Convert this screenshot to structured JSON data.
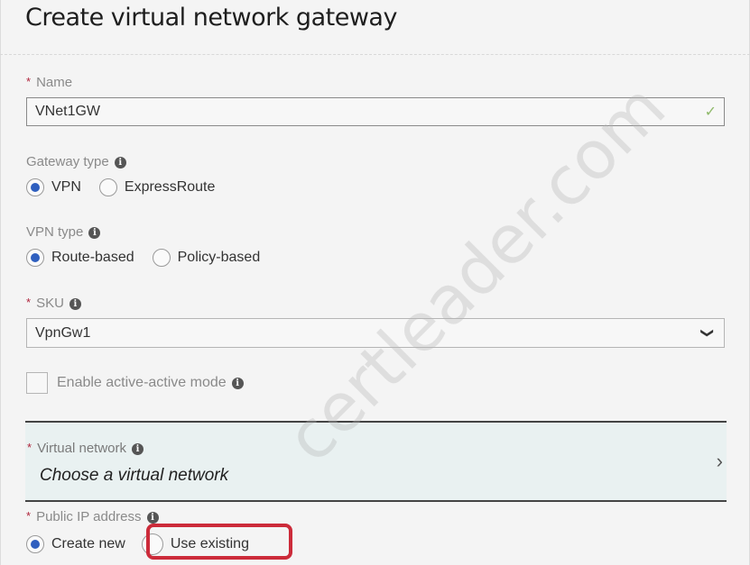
{
  "page": {
    "title": "Create virtual network gateway"
  },
  "name": {
    "label": "Name",
    "required": true,
    "value": "VNet1GW",
    "valid_icon": "checkmark-icon"
  },
  "gateway_type": {
    "label": "Gateway type",
    "options": [
      {
        "label": "VPN",
        "selected": true
      },
      {
        "label": "ExpressRoute",
        "selected": false
      }
    ]
  },
  "vpn_type": {
    "label": "VPN type",
    "options": [
      {
        "label": "Route-based",
        "selected": true
      },
      {
        "label": "Policy-based",
        "selected": false
      }
    ]
  },
  "sku": {
    "label": "SKU",
    "required": true,
    "value": "VpnGw1"
  },
  "active_active": {
    "label": "Enable active-active mode",
    "checked": false
  },
  "virtual_network": {
    "label": "Virtual network",
    "required": true,
    "value": "Choose a virtual network"
  },
  "public_ip": {
    "label": "Public IP address",
    "required": true,
    "options": [
      {
        "label": "Create new",
        "selected": true
      },
      {
        "label": "Use existing",
        "selected": false,
        "highlighted": true
      }
    ]
  },
  "icons": {
    "info": "i",
    "check": "✓",
    "chevron_down": "❯",
    "chevron_right": "›",
    "required": "*"
  },
  "watermark": "certleader.com",
  "colors": {
    "accent": "#2f5fbf",
    "required": "#b0263d",
    "highlight": "#cc2b3a",
    "valid": "#8fb96a"
  }
}
